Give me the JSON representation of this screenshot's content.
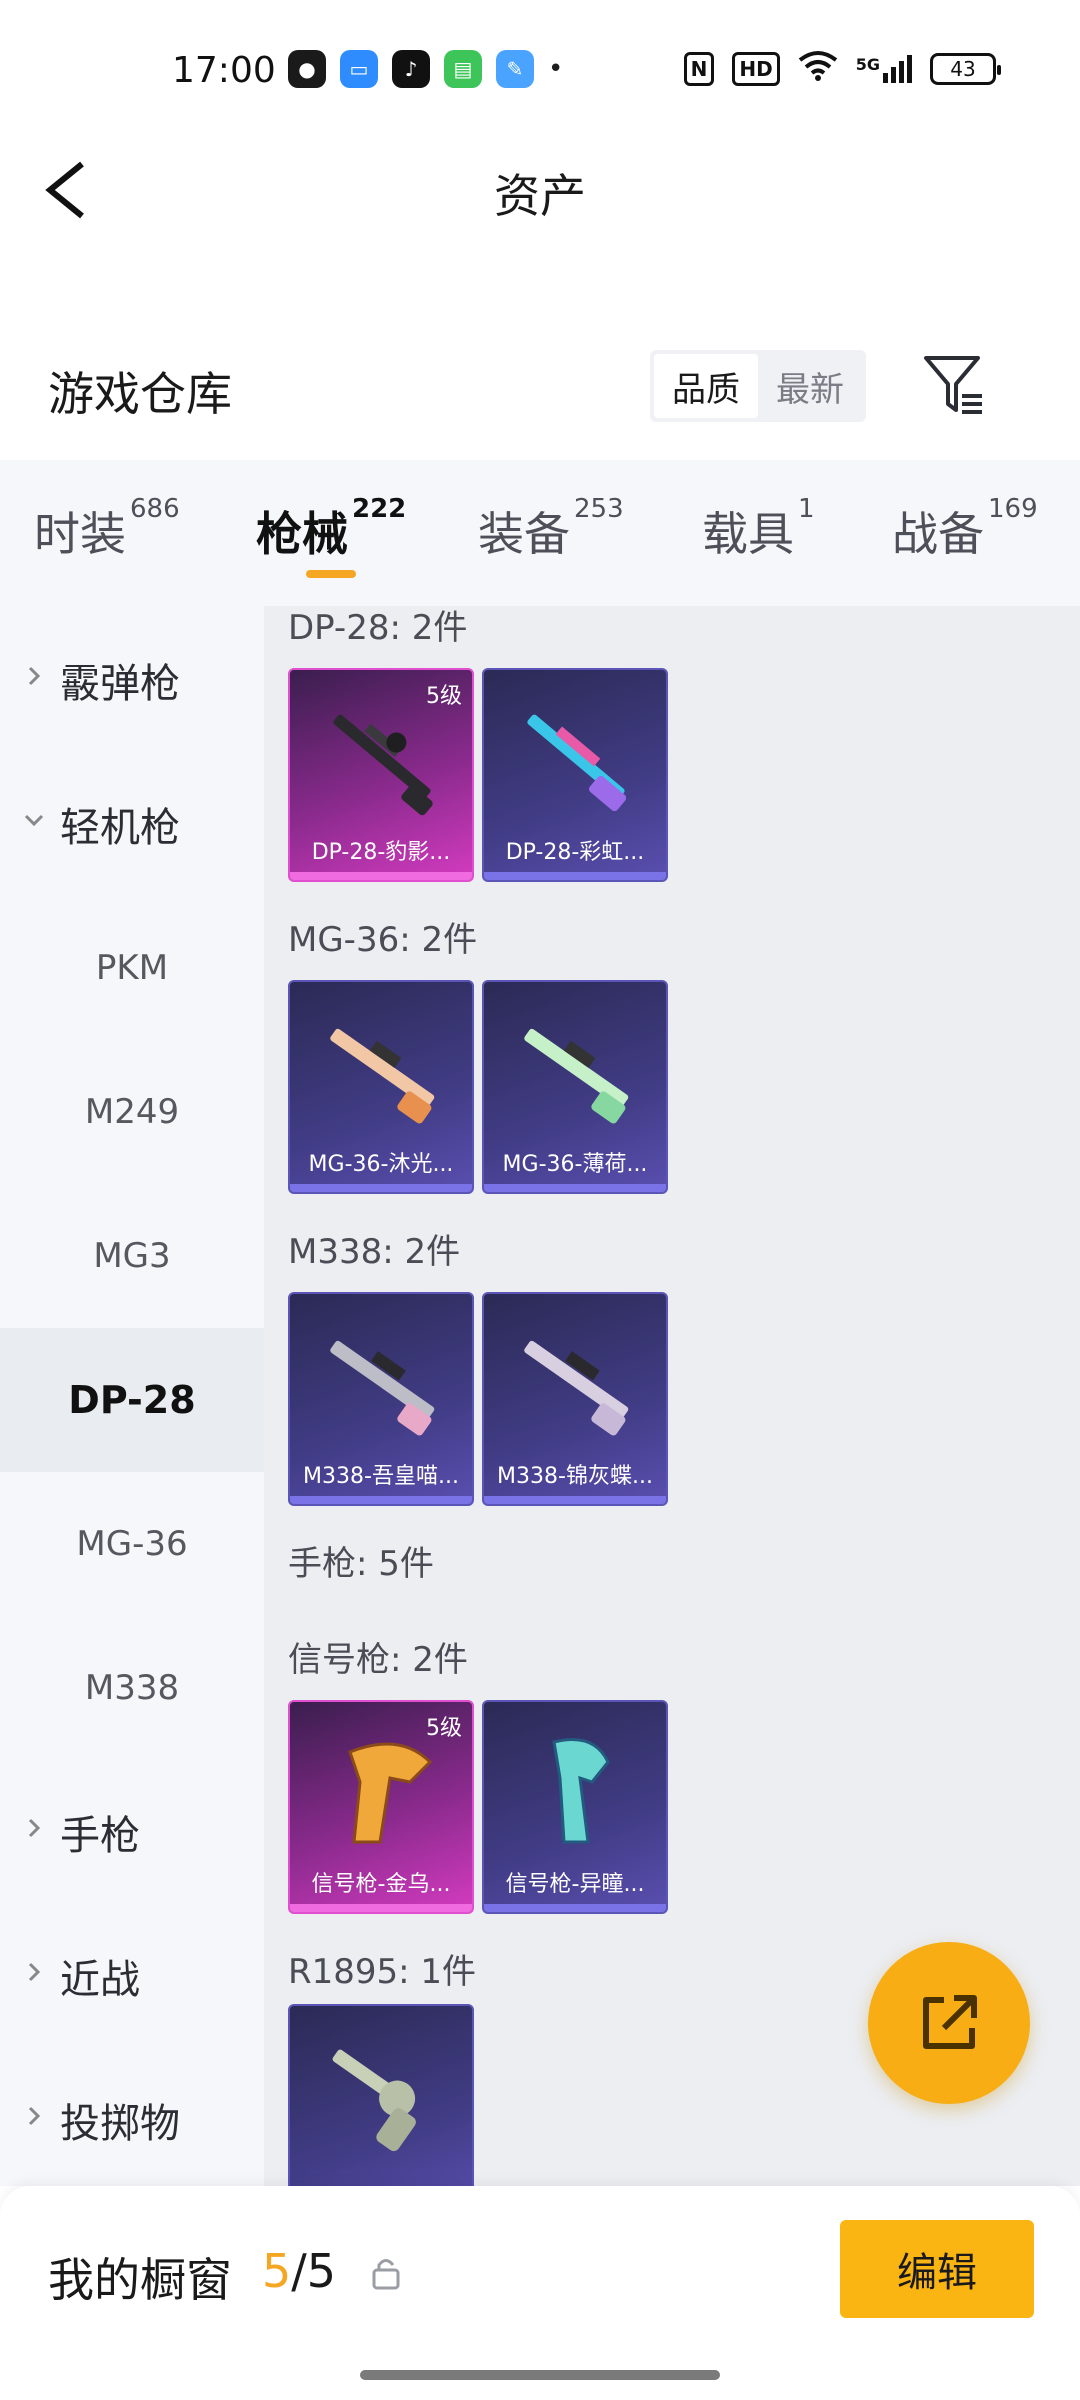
{
  "status_bar": {
    "time": "17:00",
    "battery": "43",
    "network": "5G"
  },
  "header": {
    "title": "资产"
  },
  "section": {
    "title": "游戏仓库",
    "sort_options": [
      "品质",
      "最新"
    ],
    "active_sort": "品质"
  },
  "tabs": [
    {
      "label": "时装",
      "count": "686"
    },
    {
      "label": "枪械",
      "count": "222"
    },
    {
      "label": "装备",
      "count": "253"
    },
    {
      "label": "载具",
      "count": "1"
    },
    {
      "label": "战备",
      "count": "169"
    }
  ],
  "active_tab": "枪械",
  "sidebar": {
    "items": [
      {
        "label": "霰弹枪",
        "type": "category",
        "expanded": false
      },
      {
        "label": "轻机枪",
        "type": "category",
        "expanded": true
      },
      {
        "label": "PKM",
        "type": "sub"
      },
      {
        "label": "M249",
        "type": "sub"
      },
      {
        "label": "MG3",
        "type": "sub"
      },
      {
        "label": "DP-28",
        "type": "sub",
        "selected": true
      },
      {
        "label": "MG-36",
        "type": "sub"
      },
      {
        "label": "M338",
        "type": "sub"
      },
      {
        "label": "手枪",
        "type": "category",
        "expanded": false
      },
      {
        "label": "近战",
        "type": "category",
        "expanded": false
      },
      {
        "label": "投掷物",
        "type": "category",
        "expanded": false
      }
    ]
  },
  "groups": [
    {
      "label": "DP-28: 2件",
      "items": [
        {
          "name": "DP-28-豹影...",
          "badge": "5级",
          "rarity": "legend"
        },
        {
          "name": "DP-28-彩虹...",
          "badge": "",
          "rarity": "epic"
        }
      ]
    },
    {
      "label": "MG-36: 2件",
      "items": [
        {
          "name": "MG-36-沐光...",
          "badge": "",
          "rarity": "epic"
        },
        {
          "name": "MG-36-薄荷...",
          "badge": "",
          "rarity": "epic"
        }
      ]
    },
    {
      "label": "M338: 2件",
      "items": [
        {
          "name": "M338-吾皇喵...",
          "badge": "",
          "rarity": "epic"
        },
        {
          "name": "M338-锦灰蝶...",
          "badge": "",
          "rarity": "epic"
        }
      ]
    },
    {
      "label": "手枪: 5件",
      "items": []
    },
    {
      "label": "信号枪: 2件",
      "items": [
        {
          "name": "信号枪-金乌...",
          "badge": "5级",
          "rarity": "legend"
        },
        {
          "name": "信号枪-异瞳...",
          "badge": "",
          "rarity": "epic"
        }
      ]
    },
    {
      "label": "R1895: 1件",
      "items": [
        {
          "name": "",
          "badge": "",
          "rarity": "epic"
        }
      ]
    }
  ],
  "bottom": {
    "showcase_label": "我的橱窗",
    "showcase_used": "5",
    "showcase_total": "/5",
    "edit_label": "编辑"
  },
  "colors": {
    "accent": "#f5a623",
    "edit_button": "#fbb512",
    "legend_card": "#d43bc0",
    "epic_card": "#5a4fb0"
  }
}
